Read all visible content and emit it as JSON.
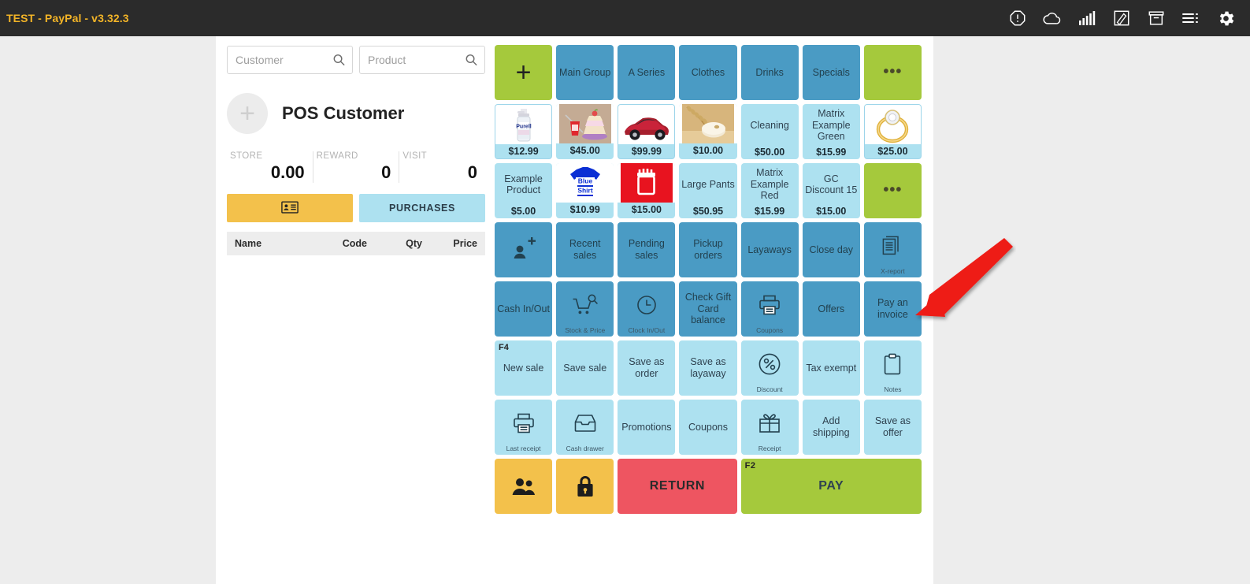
{
  "topbar": {
    "title": "TEST - PayPal - v3.32.3",
    "icons": [
      {
        "name": "alert-icon",
        "label": "alert"
      },
      {
        "name": "cloud-icon",
        "label": "cloud"
      },
      {
        "name": "signal-bars-icon",
        "label": "signal"
      },
      {
        "name": "edit-pen-icon",
        "label": "edit"
      },
      {
        "name": "archive-box-icon",
        "label": "archive"
      },
      {
        "name": "hamburger-menu-icon",
        "label": "menu"
      },
      {
        "name": "gear-icon",
        "label": "settings"
      }
    ]
  },
  "search": {
    "customer_placeholder": "Customer",
    "customer_value": "",
    "product_placeholder": "Product",
    "product_value": ""
  },
  "customer": {
    "name": "POS Customer",
    "avatar_glyph": "+"
  },
  "stats": [
    {
      "label": "STORE",
      "value": "0.00"
    },
    {
      "label": "REWARD",
      "value": "0"
    },
    {
      "label": "VISIT",
      "value": "0"
    }
  ],
  "actions": {
    "customer_card_icon": "id-card-icon",
    "purchases_label": "PURCHASES"
  },
  "cart": {
    "columns": [
      "Name",
      "Code",
      "Qty",
      "Price"
    ],
    "rows": []
  },
  "grid": {
    "rows": [
      [
        {
          "name": "add-group-button",
          "label": "",
          "style": "green",
          "glyph": "plus"
        },
        {
          "name": "group-main-group",
          "label": "Main Group",
          "style": "blue"
        },
        {
          "name": "group-a-series",
          "label": "A Series",
          "style": "blue"
        },
        {
          "name": "group-clothes",
          "label": "Clothes",
          "style": "blue"
        },
        {
          "name": "group-drinks",
          "label": "Drinks",
          "style": "blue"
        },
        {
          "name": "group-specials",
          "label": "Specials",
          "style": "blue"
        },
        {
          "name": "group-more-button",
          "label": "",
          "style": "green",
          "glyph": "ellipsis"
        }
      ],
      [
        {
          "name": "product-tile",
          "label": "",
          "style": "product",
          "price": "$12.99",
          "image": "hand-sanitizer",
          "framed": true
        },
        {
          "name": "product-tile",
          "label": "",
          "style": "product",
          "price": "$45.00",
          "image": "cake-drink"
        },
        {
          "name": "product-tile",
          "label": "",
          "style": "product",
          "price": "$99.99",
          "image": "red-car",
          "framed": true
        },
        {
          "name": "product-tile",
          "label": "",
          "style": "product",
          "price": "$10.00",
          "image": "wheat-flour"
        },
        {
          "name": "product-tile",
          "label": "Cleaning",
          "style": "product",
          "price": "$50.00"
        },
        {
          "name": "product-tile",
          "label": "Matrix Example Green",
          "style": "product",
          "price": "$15.99"
        },
        {
          "name": "product-tile",
          "label": "",
          "style": "product",
          "price": "$25.00",
          "image": "gold-ring",
          "framed": true
        }
      ],
      [
        {
          "name": "product-tile",
          "label": "Example Product",
          "style": "product",
          "price": "$5.00"
        },
        {
          "name": "product-tile",
          "label": "",
          "style": "product",
          "price": "$10.99",
          "image": "blue-shirt"
        },
        {
          "name": "product-tile",
          "label": "",
          "style": "product",
          "price": "$15.00",
          "image": "red-gift-box"
        },
        {
          "name": "product-tile",
          "label": "Large Pants",
          "style": "product",
          "price": "$50.95"
        },
        {
          "name": "product-tile",
          "label": "Matrix Example Red",
          "style": "product",
          "price": "$15.99"
        },
        {
          "name": "product-tile",
          "label": "GC Discount 15",
          "style": "product",
          "price": "$15.00"
        },
        {
          "name": "product-more-button",
          "label": "",
          "style": "green",
          "glyph": "ellipsis"
        }
      ],
      [
        {
          "name": "add-customer-button",
          "label": "",
          "style": "blue",
          "glyph": "person-plus"
        },
        {
          "name": "recent-sales-button",
          "label": "Recent sales",
          "style": "blue"
        },
        {
          "name": "pending-sales-button",
          "label": "Pending sales",
          "style": "blue"
        },
        {
          "name": "pickup-orders-button",
          "label": "Pickup orders",
          "style": "blue"
        },
        {
          "name": "layaways-button",
          "label": "Layaways",
          "style": "blue"
        },
        {
          "name": "close-day-button",
          "label": "Close day",
          "style": "blue"
        },
        {
          "name": "x-report-button",
          "label": "",
          "style": "blue",
          "glyph": "documents",
          "sub": "X-report"
        }
      ],
      [
        {
          "name": "cash-in-out-button",
          "label": "Cash In/Out",
          "style": "blue"
        },
        {
          "name": "stock-and-price-button",
          "label": "",
          "style": "blue",
          "glyph": "cart-search",
          "sub": "Stock & Price"
        },
        {
          "name": "clock-in-out-button",
          "label": "",
          "style": "blue",
          "glyph": "clock",
          "sub": "Clock In/Out"
        },
        {
          "name": "check-gift-card-balance-button",
          "label": "Check Gift Card balance",
          "style": "blue"
        },
        {
          "name": "coupons-print-button",
          "label": "",
          "style": "blue",
          "glyph": "printer",
          "sub": "Coupons"
        },
        {
          "name": "offers-button",
          "label": "Offers",
          "style": "blue"
        },
        {
          "name": "pay-an-invoice-button",
          "label": "Pay an invoice",
          "style": "blue",
          "highlighted": true
        }
      ],
      [
        {
          "name": "new-sale-button",
          "label": "New sale",
          "style": "lblue",
          "fkey": "F4"
        },
        {
          "name": "save-sale-button",
          "label": "Save sale",
          "style": "lblue"
        },
        {
          "name": "save-as-order-button",
          "label": "Save as order",
          "style": "lblue"
        },
        {
          "name": "save-as-layaway-button",
          "label": "Save as layaway",
          "style": "lblue"
        },
        {
          "name": "discount-button",
          "label": "",
          "style": "lblue",
          "glyph": "percent",
          "sub": "Discount"
        },
        {
          "name": "tax-exempt-button",
          "label": "Tax exempt",
          "style": "lblue"
        },
        {
          "name": "notes-button",
          "label": "",
          "style": "lblue",
          "glyph": "notes",
          "sub": "Notes"
        }
      ],
      [
        {
          "name": "last-receipt-button",
          "label": "",
          "style": "lblue",
          "glyph": "printer",
          "sub": "Last receipt"
        },
        {
          "name": "cash-drawer-button",
          "label": "",
          "style": "lblue",
          "glyph": "drawer",
          "sub": "Cash drawer"
        },
        {
          "name": "promotions-button",
          "label": "Promotions",
          "style": "lblue"
        },
        {
          "name": "coupons-button",
          "label": "Coupons",
          "style": "lblue"
        },
        {
          "name": "receipt-gift-button",
          "label": "",
          "style": "lblue",
          "glyph": "gift",
          "sub": "Receipt"
        },
        {
          "name": "add-shipping-button",
          "label": "Add shipping",
          "style": "lblue"
        },
        {
          "name": "save-as-offer-button",
          "label": "Save as offer",
          "style": "lblue"
        }
      ],
      [
        {
          "name": "users-button",
          "label": "",
          "style": "yellow",
          "glyph": "users"
        },
        {
          "name": "lock-button",
          "label": "",
          "style": "yellow",
          "glyph": "lock"
        },
        {
          "name": "return-button",
          "label": "RETURN",
          "style": "red",
          "span": 2,
          "big": true
        },
        {
          "name": "pay-button",
          "label": "PAY",
          "style": "green",
          "span": 3,
          "big": true,
          "fkey": "F2"
        }
      ]
    ]
  },
  "annotation": {
    "arrow_color": "#ee1c16",
    "points_to": "pay-an-invoice-button"
  },
  "colors": {
    "topbar_bg": "#2b2b2b",
    "title_text": "#f3b427",
    "page_bg": "#ededed",
    "panel_bg": "#ffffff",
    "green": "#a5c93c",
    "blue": "#4a9bc4",
    "light_blue": "#ade1f0",
    "yellow": "#f3c14b",
    "red": "#ee5561"
  }
}
